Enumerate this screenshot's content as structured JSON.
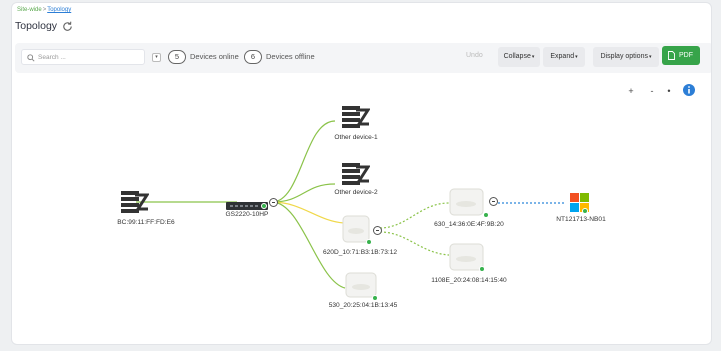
{
  "breadcrumb": {
    "parent": "Site-wide",
    "separator": ">",
    "current": "Topology"
  },
  "page_title": "Topology",
  "toolbar": {
    "search_placeholder": "Search ...",
    "online_count": "5",
    "online_label": "Devices online",
    "offline_count": "6",
    "offline_label": "Devices offline",
    "undo_label": "Undo",
    "collapse_label": "Collapse",
    "expand_label": "Expand",
    "display_options_label": "Display options",
    "pdf_label": "PDF"
  },
  "zoom_controls": {
    "zoom_in": "+",
    "zoom_out": "-",
    "reset": "•"
  },
  "colors": {
    "accent_green": "#37a44a",
    "online_dot": "#37b24d",
    "link_primary": "#8bc34a",
    "link_secondary": "#f0d84a",
    "link_wireless": "#2c88d9"
  },
  "topology": {
    "nodes": [
      {
        "id": "bc",
        "label": "BC:99:11:FF:FD:E6",
        "icon": "firewall-icon",
        "online": false
      },
      {
        "id": "sw",
        "label": "GS2220-10HP",
        "icon": "switch-icon",
        "online": true
      },
      {
        "id": "other1",
        "label": "Other device-1",
        "icon": "firewall-icon",
        "online": false
      },
      {
        "id": "other2",
        "label": "Other device-2",
        "icon": "firewall-icon",
        "online": false
      },
      {
        "id": "ap200",
        "label": "620D_10:71:B3:1B:73:12",
        "icon": "access-point-icon",
        "online": true
      },
      {
        "id": "ap530",
        "label": "530_20:25:04:1B:13:45",
        "icon": "access-point-icon",
        "online": true
      },
      {
        "id": "ap630",
        "label": "630_14:36:0E:4F:9B:20",
        "icon": "access-point-icon",
        "online": true
      },
      {
        "id": "ap1108",
        "label": "1108E_20:24:08:14:15:40",
        "icon": "access-point-icon",
        "online": true
      },
      {
        "id": "win",
        "label": "NT121713-NB01",
        "icon": "windows-icon",
        "online": true
      }
    ]
  }
}
